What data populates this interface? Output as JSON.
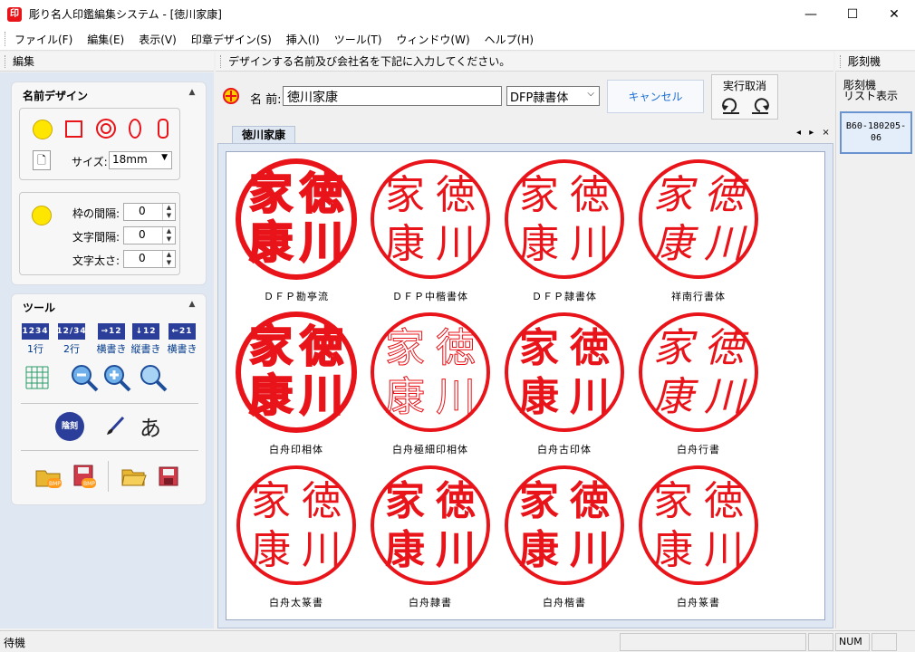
{
  "window": {
    "title": "彫り名人印鑑編集システム - [徳川家康]",
    "icon_text": "印",
    "minimize": "—",
    "maximize": "☐",
    "close": "✕"
  },
  "menu": [
    "ファイル(F)",
    "編集(E)",
    "表示(V)",
    "印章デザイン(S)",
    "挿入(I)",
    "ツール(T)",
    "ウィンドウ(W)",
    "ヘルプ(H)"
  ],
  "panes": {
    "left_title": "編集",
    "main_title": "デザインする名前及び会社名を下記に入力してください。",
    "right_title": "彫刻機"
  },
  "name_design": {
    "title": "名前デザイン",
    "size_label": "サイズ:",
    "size_value": "18mm",
    "spacing": [
      {
        "label": "枠の間隔:",
        "value": "0"
      },
      {
        "label": "文字間隔:",
        "value": "0"
      },
      {
        "label": "文字太さ:",
        "value": "0"
      }
    ]
  },
  "tools": {
    "title": "ツール",
    "layout_buttons": [
      {
        "icon": "1234",
        "label": "1行"
      },
      {
        "icon": "12/34",
        "label": "2行"
      },
      {
        "icon": "→12",
        "label": "横書き"
      },
      {
        "icon": "↓12",
        "label": "縦書き"
      },
      {
        "icon": "←21",
        "label": "横書き"
      }
    ],
    "engrave_icon_text": "陰刻",
    "kana_icon_text": "あ"
  },
  "name_bar": {
    "name_label": "名 前:",
    "name_value": "徳川家康",
    "font_value": "DFP隷書体",
    "cancel_label": "キャンセル",
    "undo_label": "実行取消"
  },
  "tab": {
    "label": "徳川家康",
    "arrows": "◂ ▸ ×"
  },
  "stamps": {
    "text_right": [
      "徳",
      "川"
    ],
    "text_left": [
      "家",
      "康"
    ],
    "items": [
      {
        "label": "ＤＦＰ勘亭流",
        "weight": 900,
        "family": "serif",
        "style": "heavy"
      },
      {
        "label": "ＤＦＰ中楷書体",
        "weight": 400,
        "family": "serif",
        "style": "normal"
      },
      {
        "label": "ＤＦＰ隷書体",
        "weight": 500,
        "family": "sans",
        "style": "normal"
      },
      {
        "label": "祥南行書体",
        "weight": 400,
        "family": "serif",
        "style": "italic"
      },
      {
        "label": "白舟印相体",
        "weight": 900,
        "family": "sans",
        "style": "heavy"
      },
      {
        "label": "白舟極細印相体",
        "weight": 100,
        "family": "sans",
        "style": "outline"
      },
      {
        "label": "白舟古印体",
        "weight": 700,
        "family": "serif",
        "style": "normal"
      },
      {
        "label": "白舟行書",
        "weight": 400,
        "family": "serif",
        "style": "italic"
      },
      {
        "label": "白舟太篆書",
        "weight": 400,
        "family": "sans",
        "style": "seal"
      },
      {
        "label": "白舟隷書",
        "weight": 700,
        "family": "serif",
        "style": "normal"
      },
      {
        "label": "白舟楷書",
        "weight": 700,
        "family": "serif",
        "style": "normal"
      },
      {
        "label": "白舟篆書",
        "weight": 300,
        "family": "sans",
        "style": "seal"
      }
    ],
    "color": "#e8141a"
  },
  "right_panel": {
    "list_label_1": "彫刻機",
    "list_label_2": "リスト表示",
    "machine": "B60-180205-06"
  },
  "status": {
    "text": "待機",
    "num": "NUM"
  }
}
